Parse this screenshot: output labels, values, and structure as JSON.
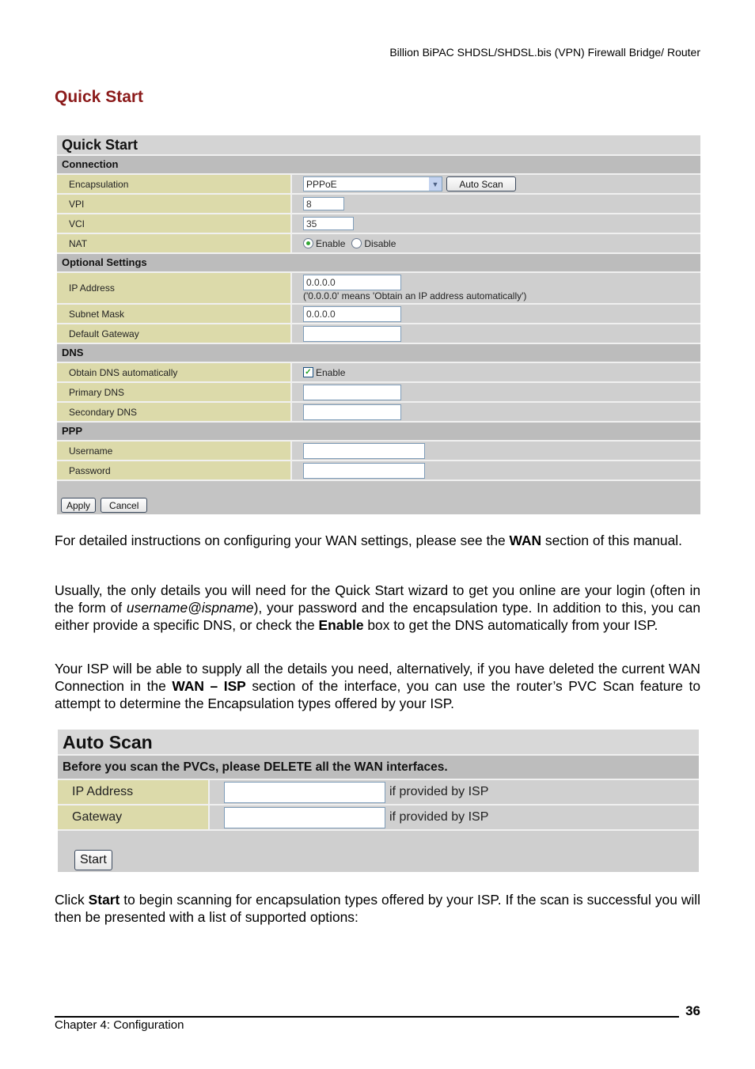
{
  "header": {
    "product_title": "Billion BiPAC SHDSL/SHDSL.bis (VPN) Firewall Bridge/ Router"
  },
  "section_title": "Quick Start",
  "quick_start": {
    "title": "Quick Start",
    "sections": {
      "connection": "Connection",
      "optional": "Optional Settings",
      "dns": "DNS",
      "ppp": "PPP"
    },
    "encapsulation": {
      "label": "Encapsulation",
      "value": "PPPoE",
      "auto_scan_label": "Auto Scan"
    },
    "vpi": {
      "label": "VPI",
      "value": "8"
    },
    "vci": {
      "label": "VCI",
      "value": "35"
    },
    "nat": {
      "label": "NAT",
      "options": [
        "Enable",
        "Disable"
      ],
      "selected": "Enable"
    },
    "ip_address": {
      "label": "IP Address",
      "value": "0.0.0.0",
      "hint": "('0.0.0.0' means 'Obtain an IP address automatically')"
    },
    "subnet_mask": {
      "label": "Subnet Mask",
      "value": "0.0.0.0"
    },
    "default_gateway": {
      "label": "Default Gateway",
      "value": ""
    },
    "obtain_dns": {
      "label": "Obtain DNS automatically",
      "checkbox_label": "Enable",
      "checked": true
    },
    "primary_dns": {
      "label": "Primary DNS",
      "value": ""
    },
    "secondary_dns": {
      "label": "Secondary DNS",
      "value": ""
    },
    "username": {
      "label": "Username",
      "value": ""
    },
    "password": {
      "label": "Password",
      "value": ""
    },
    "buttons": {
      "apply": "Apply",
      "cancel": "Cancel"
    }
  },
  "paragraphs": {
    "p1": {
      "a": "For detailed instructions on configuring your WAN settings, please see the ",
      "b": "WAN",
      "c": " section of this manual."
    },
    "p2": {
      "a": "Usually, the only details you will need for the Quick Start wizard to get you online are your login (often in the form of ",
      "b": "username@ispname",
      "c": "), your password and the encapsulation type. In addition to this, you can either provide a specific DNS, or check the ",
      "d": "Enable",
      "e": " box to get the DNS automatically from your ISP."
    },
    "p3": {
      "a": "Your ISP will be able to supply all the details you need, alternatively, if you have deleted the current WAN Connection in the ",
      "b": "WAN – ISP",
      "c": " section of the interface, you can use the router’s PVC Scan feature to attempt to determine the Encapsulation types offered by your ISP."
    },
    "p4": {
      "a": "Click ",
      "b": "Start",
      "c": " to begin scanning for encapsulation types offered by your ISP. If the scan is successful you will then be presented with a list of supported options:"
    }
  },
  "auto_scan": {
    "title": "Auto Scan",
    "notice": "Before you scan the PVCs, please DELETE all the WAN interfaces.",
    "ip_address": {
      "label": "IP Address",
      "value": "",
      "hint": "if provided by ISP"
    },
    "gateway": {
      "label": "Gateway",
      "value": "",
      "hint": "if provided by ISP"
    },
    "start_label": "Start"
  },
  "footer": {
    "page_number": "36",
    "chapter": "Chapter 4: Configuration"
  }
}
